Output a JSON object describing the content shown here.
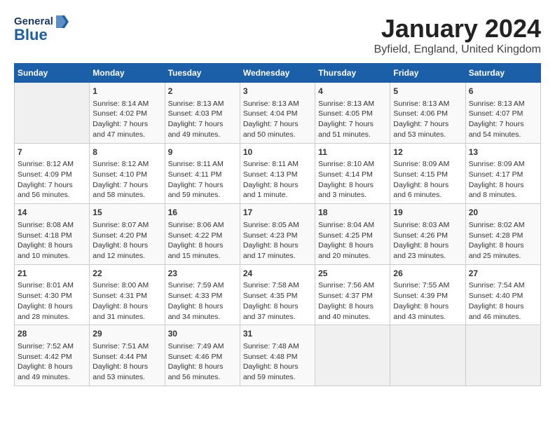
{
  "header": {
    "logo_general": "General",
    "logo_blue": "Blue",
    "month_title": "January 2024",
    "location": "Byfield, England, United Kingdom"
  },
  "days_of_week": [
    "Sunday",
    "Monday",
    "Tuesday",
    "Wednesday",
    "Thursday",
    "Friday",
    "Saturday"
  ],
  "weeks": [
    [
      {
        "day": "",
        "empty": true
      },
      {
        "day": "1",
        "sunrise": "8:14 AM",
        "sunset": "4:02 PM",
        "daylight": "7 hours and 47 minutes."
      },
      {
        "day": "2",
        "sunrise": "8:13 AM",
        "sunset": "4:03 PM",
        "daylight": "7 hours and 49 minutes."
      },
      {
        "day": "3",
        "sunrise": "8:13 AM",
        "sunset": "4:04 PM",
        "daylight": "7 hours and 50 minutes."
      },
      {
        "day": "4",
        "sunrise": "8:13 AM",
        "sunset": "4:05 PM",
        "daylight": "7 hours and 51 minutes."
      },
      {
        "day": "5",
        "sunrise": "8:13 AM",
        "sunset": "4:06 PM",
        "daylight": "7 hours and 53 minutes."
      },
      {
        "day": "6",
        "sunrise": "8:13 AM",
        "sunset": "4:07 PM",
        "daylight": "7 hours and 54 minutes."
      }
    ],
    [
      {
        "day": "7",
        "sunrise": "8:12 AM",
        "sunset": "4:09 PM",
        "daylight": "7 hours and 56 minutes."
      },
      {
        "day": "8",
        "sunrise": "8:12 AM",
        "sunset": "4:10 PM",
        "daylight": "7 hours and 58 minutes."
      },
      {
        "day": "9",
        "sunrise": "8:11 AM",
        "sunset": "4:11 PM",
        "daylight": "7 hours and 59 minutes."
      },
      {
        "day": "10",
        "sunrise": "8:11 AM",
        "sunset": "4:13 PM",
        "daylight": "8 hours and 1 minute."
      },
      {
        "day": "11",
        "sunrise": "8:10 AM",
        "sunset": "4:14 PM",
        "daylight": "8 hours and 3 minutes."
      },
      {
        "day": "12",
        "sunrise": "8:09 AM",
        "sunset": "4:15 PM",
        "daylight": "8 hours and 6 minutes."
      },
      {
        "day": "13",
        "sunrise": "8:09 AM",
        "sunset": "4:17 PM",
        "daylight": "8 hours and 8 minutes."
      }
    ],
    [
      {
        "day": "14",
        "sunrise": "8:08 AM",
        "sunset": "4:18 PM",
        "daylight": "8 hours and 10 minutes."
      },
      {
        "day": "15",
        "sunrise": "8:07 AM",
        "sunset": "4:20 PM",
        "daylight": "8 hours and 12 minutes."
      },
      {
        "day": "16",
        "sunrise": "8:06 AM",
        "sunset": "4:22 PM",
        "daylight": "8 hours and 15 minutes."
      },
      {
        "day": "17",
        "sunrise": "8:05 AM",
        "sunset": "4:23 PM",
        "daylight": "8 hours and 17 minutes."
      },
      {
        "day": "18",
        "sunrise": "8:04 AM",
        "sunset": "4:25 PM",
        "daylight": "8 hours and 20 minutes."
      },
      {
        "day": "19",
        "sunrise": "8:03 AM",
        "sunset": "4:26 PM",
        "daylight": "8 hours and 23 minutes."
      },
      {
        "day": "20",
        "sunrise": "8:02 AM",
        "sunset": "4:28 PM",
        "daylight": "8 hours and 25 minutes."
      }
    ],
    [
      {
        "day": "21",
        "sunrise": "8:01 AM",
        "sunset": "4:30 PM",
        "daylight": "8 hours and 28 minutes."
      },
      {
        "day": "22",
        "sunrise": "8:00 AM",
        "sunset": "4:31 PM",
        "daylight": "8 hours and 31 minutes."
      },
      {
        "day": "23",
        "sunrise": "7:59 AM",
        "sunset": "4:33 PM",
        "daylight": "8 hours and 34 minutes."
      },
      {
        "day": "24",
        "sunrise": "7:58 AM",
        "sunset": "4:35 PM",
        "daylight": "8 hours and 37 minutes."
      },
      {
        "day": "25",
        "sunrise": "7:56 AM",
        "sunset": "4:37 PM",
        "daylight": "8 hours and 40 minutes."
      },
      {
        "day": "26",
        "sunrise": "7:55 AM",
        "sunset": "4:39 PM",
        "daylight": "8 hours and 43 minutes."
      },
      {
        "day": "27",
        "sunrise": "7:54 AM",
        "sunset": "4:40 PM",
        "daylight": "8 hours and 46 minutes."
      }
    ],
    [
      {
        "day": "28",
        "sunrise": "7:52 AM",
        "sunset": "4:42 PM",
        "daylight": "8 hours and 49 minutes."
      },
      {
        "day": "29",
        "sunrise": "7:51 AM",
        "sunset": "4:44 PM",
        "daylight": "8 hours and 53 minutes."
      },
      {
        "day": "30",
        "sunrise": "7:49 AM",
        "sunset": "4:46 PM",
        "daylight": "8 hours and 56 minutes."
      },
      {
        "day": "31",
        "sunrise": "7:48 AM",
        "sunset": "4:48 PM",
        "daylight": "8 hours and 59 minutes."
      },
      {
        "day": "",
        "empty": true
      },
      {
        "day": "",
        "empty": true
      },
      {
        "day": "",
        "empty": true
      }
    ]
  ]
}
